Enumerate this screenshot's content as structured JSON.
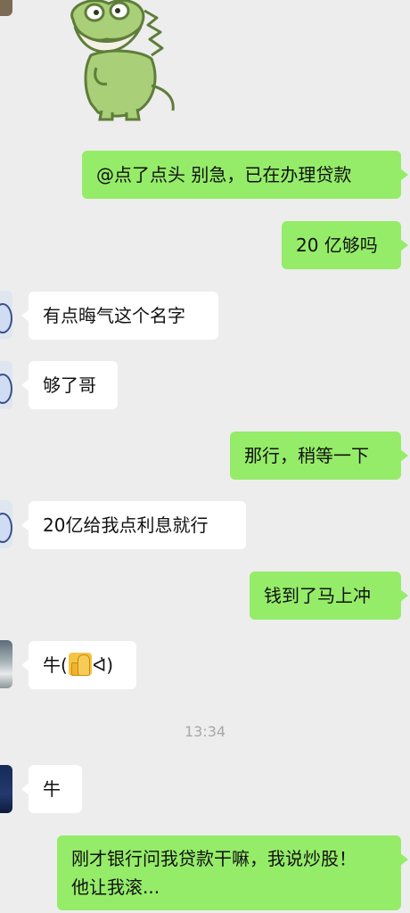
{
  "colors": {
    "background": "#ededed",
    "outgoing_bubble": "#95ec69",
    "incoming_bubble": "#ffffff",
    "timestamp_text": "#a8a8a8"
  },
  "sticker": {
    "icon": "green-dinosaur-sticker"
  },
  "messages": [
    {
      "side": "out",
      "text": "@点了点头 别急，已在办理贷款"
    },
    {
      "side": "out",
      "text": "20 亿够吗"
    },
    {
      "side": "in",
      "text": "有点晦气这个名字",
      "avatar": "cartoon-avatar"
    },
    {
      "side": "in",
      "text": "够了哥",
      "avatar": "cartoon-avatar"
    },
    {
      "side": "out",
      "text": "那行，稍等一下"
    },
    {
      "side": "in",
      "text": "20亿给我点利息就行",
      "avatar": "cartoon-avatar"
    },
    {
      "side": "out",
      "text": "钱到了马上冲"
    },
    {
      "side": "in",
      "text_before": "牛(",
      "emoji": "thumbs-up-emoji",
      "text_after": "ᐊ̇)",
      "avatar": "photo-avatar"
    },
    {
      "side": "in",
      "text": "牛",
      "avatar": "dark-avatar"
    },
    {
      "side": "out",
      "lines": [
        "刚才银行问我贷款干嘛，我说炒股！",
        "他让我滚..."
      ]
    }
  ],
  "timestamp": "13:34"
}
